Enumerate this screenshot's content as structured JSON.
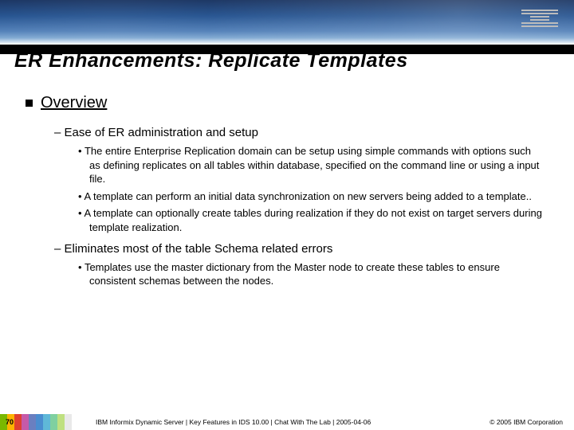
{
  "slide_number": "70",
  "logo_name": "IBM",
  "title": "ER Enhancements: Replicate Templates",
  "content": {
    "l1": "Overview",
    "s1": {
      "head": "Ease of ER administration and setup",
      "b1": "The entire Enterprise Replication domain can be setup using simple commands with options such as defining replicates on all tables within database, specified on the command line or using a input file.",
      "b2": "A template can perform an initial data synchronization on new servers being added to a template..",
      "b3": "A template can optionally create tables during realization if they do not exist on target servers during template realization."
    },
    "s2": {
      "head": "Eliminates most of the table Schema related errors",
      "b1": "Templates use the master dictionary from the Master node to create these tables to ensure consistent schemas between the nodes."
    }
  },
  "footer": {
    "center": "IBM Informix Dynamic Server | Key Features in IDS 10.00 | Chat With The Lab | 2005-04-06",
    "right": "© 2005 IBM Corporation"
  },
  "stripe_colors": [
    "#7ab800",
    "#ffb300",
    "#e04030",
    "#c65aa8",
    "#6a7fc0",
    "#4a8dd0",
    "#5fb8d8",
    "#7fd0a0",
    "#bfe080",
    "#e9e9e9"
  ]
}
